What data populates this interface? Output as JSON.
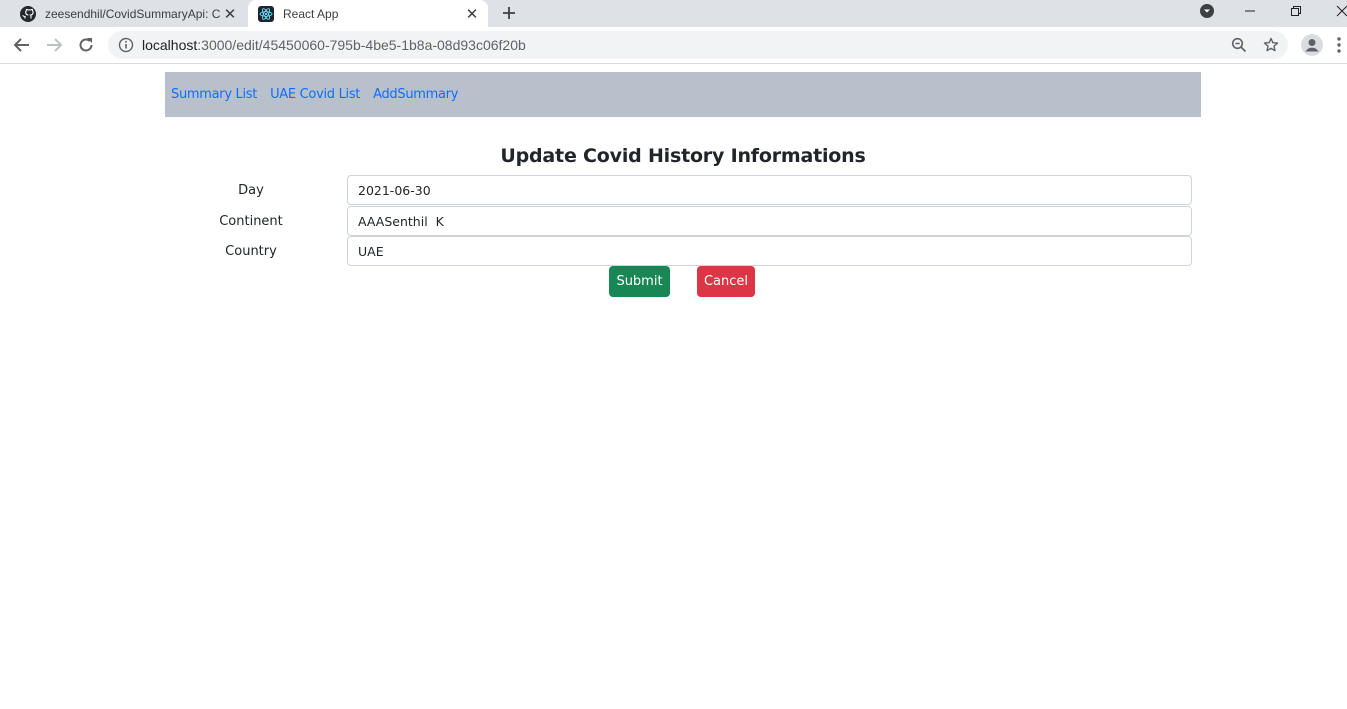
{
  "browser": {
    "tabs": [
      {
        "title": "zeesendhil/CovidSummaryApi: Co",
        "icon": "github-icon",
        "active": false
      },
      {
        "title": "React App",
        "icon": "react-icon",
        "active": true
      }
    ],
    "url_host": "localhost",
    "url_rest": ":3000/edit/45450060-795b-4be5-1b8a-08d93c06f20b"
  },
  "nav": {
    "links": [
      "Summary List",
      "UAE Covid List",
      "AddSummary"
    ],
    "link_color": "#0d6efd",
    "background": "#b8c0cb"
  },
  "form": {
    "title": "Update Covid History Informations",
    "fields": [
      {
        "label": "Day",
        "value": "2021-06-30"
      },
      {
        "label": "Continent",
        "value": "AAASenthil  K"
      },
      {
        "label": "Country",
        "value": "UAE"
      }
    ],
    "submit_label": "Submit",
    "cancel_label": "Cancel",
    "submit_color": "#198754",
    "cancel_color": "#dc3545"
  }
}
